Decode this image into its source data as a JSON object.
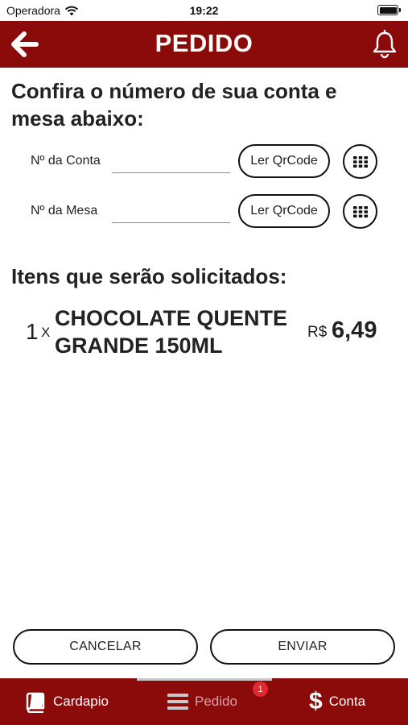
{
  "status_bar": {
    "carrier": "Operadora",
    "time": "19:22"
  },
  "header": {
    "title": "PEDIDO"
  },
  "instructions": "Confira o número de sua conta e mesa abaixo:",
  "fields": {
    "conta": {
      "label": "Nº da Conta",
      "value": "",
      "qr_label": "Ler QrCode"
    },
    "mesa": {
      "label": "Nº da Mesa",
      "value": "",
      "qr_label": "Ler QrCode"
    }
  },
  "items_title": "Itens que serão solicitados:",
  "items": [
    {
      "quantity": "1",
      "multiplier": "X",
      "name": "CHOCOLATE QUENTE GRANDE 150ML",
      "currency": "R$",
      "price": "6,49"
    }
  ],
  "buttons": {
    "cancel": "CANCELAR",
    "send": "ENVIAR"
  },
  "tabbar": {
    "tabs": [
      {
        "label": "Cardapio",
        "icon": "book-icon"
      },
      {
        "label": "Pedido",
        "icon": "list-icon",
        "active": true
      },
      {
        "label": "Conta",
        "icon": "dollar-icon",
        "glyph": "$"
      }
    ],
    "badge": "1"
  },
  "colors": {
    "brand": "#8b0b0b",
    "badge": "#e0282f",
    "inactive_tab": "#d9a3a3"
  }
}
